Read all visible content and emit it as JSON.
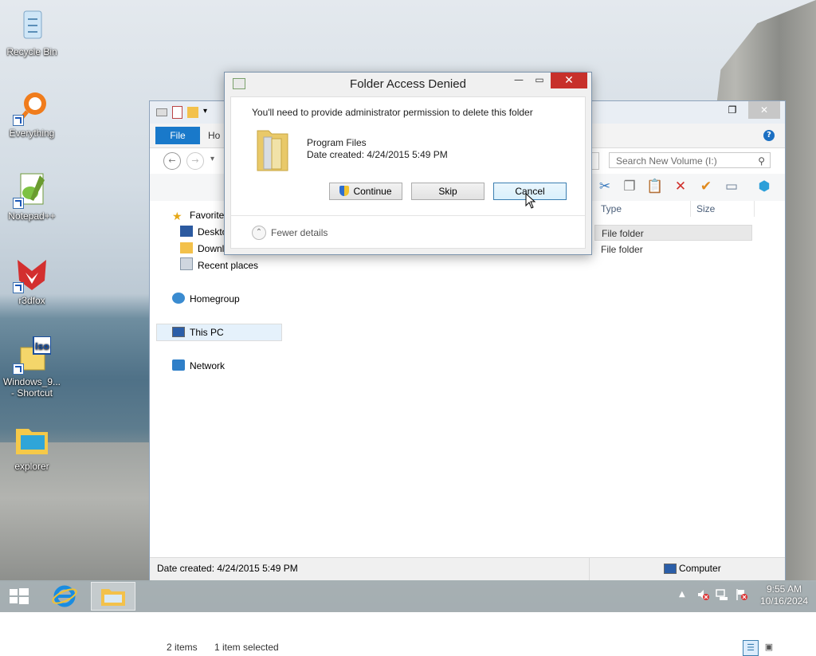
{
  "desktop": {
    "icons": [
      {
        "label": "Recycle Bin",
        "icon": "recycle-bin-icon"
      },
      {
        "label": "Everything",
        "icon": "everything-search-icon"
      },
      {
        "label": "Notepad++",
        "icon": "notepad-plus-plus-icon"
      },
      {
        "label": "r3dfox",
        "icon": "r3dfox-browser-icon"
      },
      {
        "label": "Windows_9... - Shortcut",
        "icon": "iso-file-icon"
      },
      {
        "label": "explorer",
        "icon": "explorer-folder-icon"
      }
    ]
  },
  "explorer": {
    "ribbon": {
      "file_tab": "File",
      "home_tab": "Ho"
    },
    "search_placeholder": "Search New Volume (I:)",
    "nav": {
      "favorites": "Favorites",
      "desktop": "Deskto",
      "downloads": "Downl",
      "recent": "Recent places",
      "homegroup": "Homegroup",
      "this_pc": "This PC",
      "network": "Network"
    },
    "columns": {
      "type": "Type",
      "size": "Size"
    },
    "rows": [
      {
        "type": "File folder"
      },
      {
        "type": "File folder"
      }
    ],
    "status": {
      "items": "2 items",
      "selected": "1 item selected"
    },
    "details": {
      "date_created": "Date created: 4/24/2015 5:49 PM",
      "location": "Computer"
    }
  },
  "dialog": {
    "title": "Folder Access Denied",
    "message": "You'll need to provide administrator permission to delete this folder",
    "folder_name": "Program Files",
    "date_created": "Date created: 4/24/2015 5:49 PM",
    "buttons": {
      "continue": "Continue",
      "skip": "Skip",
      "cancel": "Cancel"
    },
    "fewer_details": "Fewer details"
  },
  "taskbar": {
    "time": "9:55 AM",
    "date": "10/16/2024"
  },
  "colors": {
    "accent": "#1979ca",
    "close": "#c7302b"
  }
}
